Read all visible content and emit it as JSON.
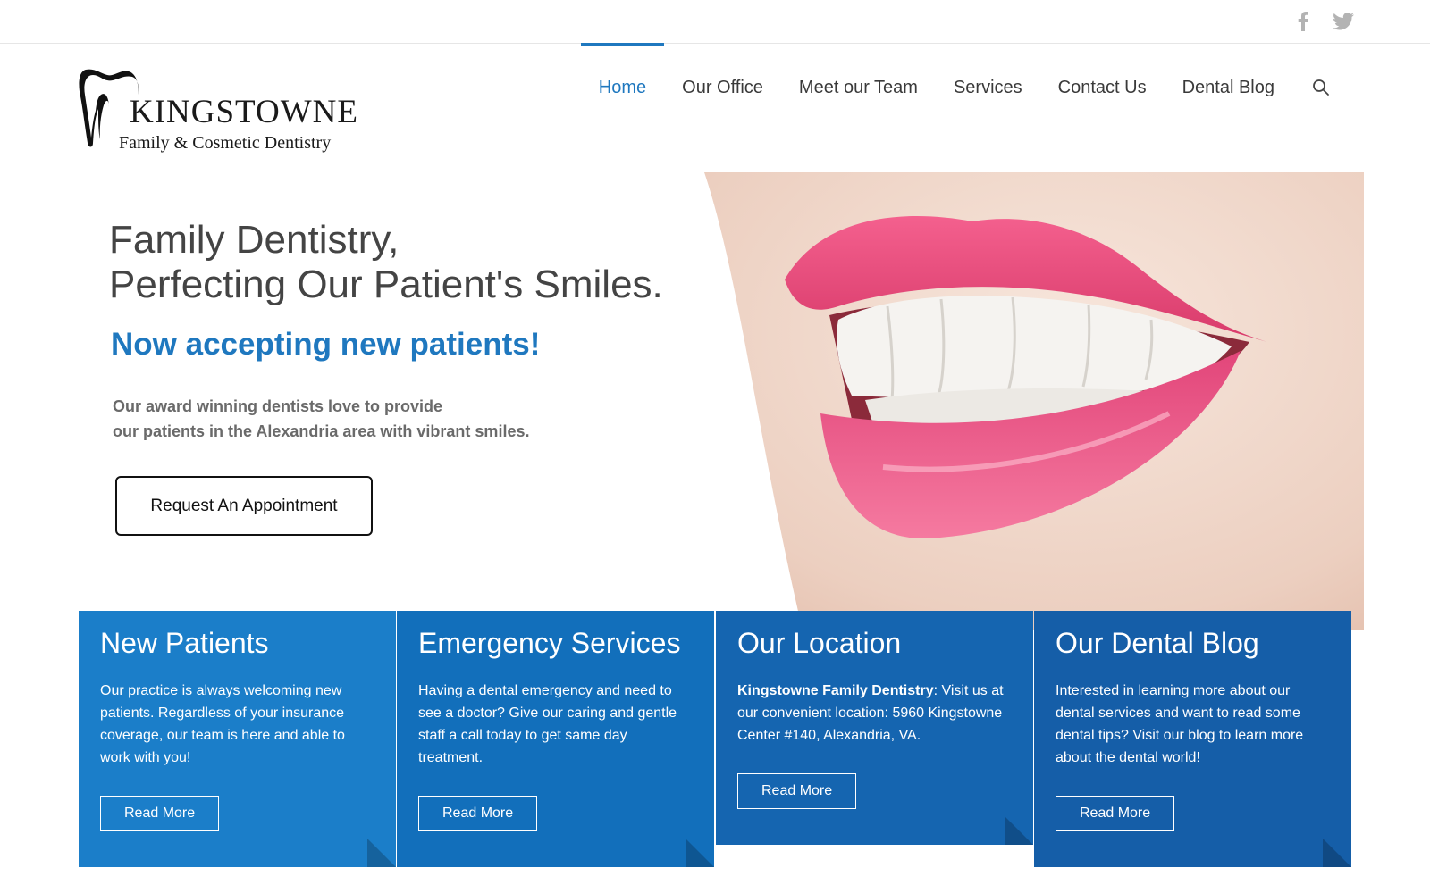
{
  "social": {
    "facebook_icon": "facebook-icon",
    "twitter_icon": "twitter-icon"
  },
  "logo": {
    "name": "KINGSTOWNE",
    "subtitle": "Family & Cosmetic Dentistry"
  },
  "nav": {
    "items": [
      {
        "label": "Home",
        "active": true
      },
      {
        "label": "Our Office"
      },
      {
        "label": "Meet our Team"
      },
      {
        "label": "Services"
      },
      {
        "label": "Contact Us"
      },
      {
        "label": "Dental Blog"
      }
    ],
    "search_icon": "search-icon"
  },
  "hero": {
    "title_line1": "Family Dentistry,",
    "title_line2": "Perfecting Our Patient's Smiles.",
    "accent": "Now accepting new patients!",
    "text_line1": "Our award winning dentists love to provide",
    "text_line2": "our patients in the Alexandria area with vibrant smiles.",
    "cta_label": "Request An Appointment"
  },
  "boxes": [
    {
      "title": "New Patients",
      "text": "Our practice is always welcoming new patients. Regardless of your insurance coverage, our team is here and able to work with you!",
      "button": "Read More"
    },
    {
      "title": "Emergency Services",
      "text": "Having a dental emergency and need to see a doctor? Give our caring and gentle staff a call today to get same day treatment.",
      "button": "Read More"
    },
    {
      "title": "Our Location",
      "text_bold": "Kingstowne Family Dentistry",
      "text": ": Visit us at our convenient location: 5960 Kingstowne Center #140, Alexandria, VA.",
      "button": "Read More"
    },
    {
      "title": "Our Dental Blog",
      "text": "Interested in learning more about our dental services and want to read some dental tips? Visit our blog to learn more about the dental world!",
      "button": "Read More"
    }
  ],
  "colors": {
    "accent": "#1f78bf",
    "box1": "#1b7ec9",
    "box2": "#126fbb",
    "box3": "#1565b0",
    "box4": "#155ea8"
  }
}
